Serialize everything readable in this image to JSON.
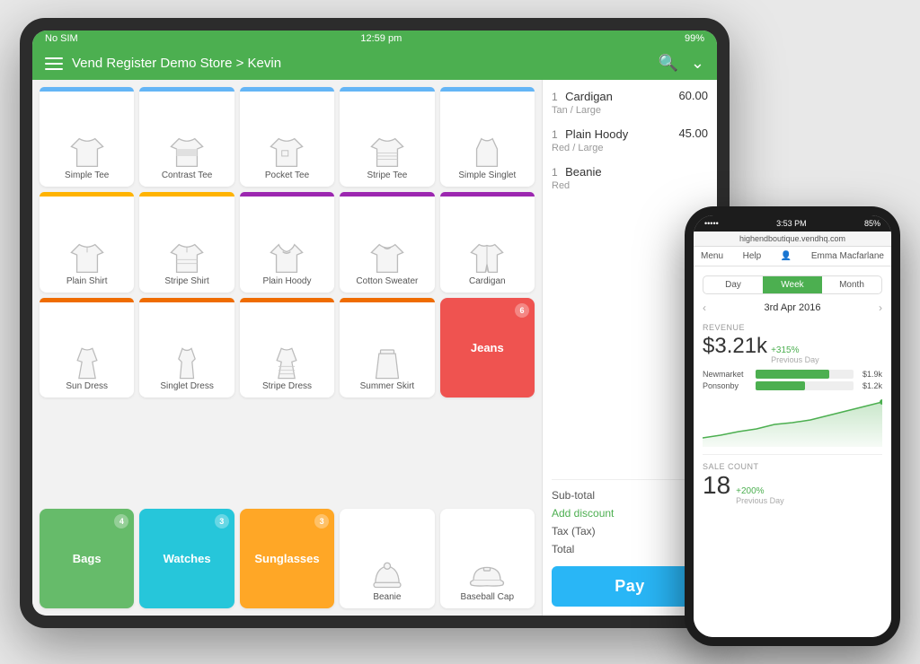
{
  "tablet": {
    "status_bar": {
      "carrier": "No SIM",
      "wifi": "wifi",
      "time": "12:59 pm",
      "battery": "99%"
    },
    "header": {
      "title": "Vend Register Demo Store > Kevin",
      "search_icon": "search",
      "chevron_icon": "chevron-down"
    },
    "products": [
      {
        "id": "simple-tee",
        "label": "Simple Tee",
        "bar_color": "bar-blue",
        "icon": "tee",
        "colored": false
      },
      {
        "id": "contrast-tee",
        "label": "Contrast Tee",
        "bar_color": "bar-blue",
        "icon": "contrast-tee",
        "colored": false
      },
      {
        "id": "pocket-tee",
        "label": "Pocket Tee",
        "bar_color": "bar-blue",
        "icon": "pocket-tee",
        "colored": false
      },
      {
        "id": "stripe-tee",
        "label": "Stripe Tee",
        "bar_color": "bar-blue",
        "icon": "stripe-tee",
        "colored": false
      },
      {
        "id": "simple-singlet",
        "label": "Simple Singlet",
        "bar_color": "bar-blue",
        "icon": "singlet",
        "colored": false
      },
      {
        "id": "plain-shirt",
        "label": "Plain Shirt",
        "bar_color": "bar-yellow",
        "icon": "shirt",
        "colored": false
      },
      {
        "id": "stripe-shirt",
        "label": "Stripe Shirt",
        "bar_color": "bar-yellow",
        "icon": "stripe-shirt",
        "colored": false
      },
      {
        "id": "plain-hoody",
        "label": "Plain Hoody",
        "bar_color": "bar-purple",
        "icon": "hoodie",
        "colored": false
      },
      {
        "id": "cotton-sweater",
        "label": "Cotton Sweater",
        "bar_color": "bar-purple",
        "icon": "sweater",
        "colored": false
      },
      {
        "id": "cardigan",
        "label": "Cardigan",
        "bar_color": "bar-purple",
        "icon": "cardigan",
        "colored": false
      },
      {
        "id": "sun-dress",
        "label": "Sun Dress",
        "bar_color": "bar-orange",
        "icon": "dress",
        "colored": false
      },
      {
        "id": "singlet-dress",
        "label": "Singlet Dress",
        "bar_color": "bar-orange",
        "icon": "singlet-dress",
        "colored": false
      },
      {
        "id": "stripe-dress",
        "label": "Stripe Dress",
        "bar_color": "bar-orange",
        "icon": "stripe-dress",
        "colored": false
      },
      {
        "id": "summer-skirt",
        "label": "Summer Skirt",
        "bar_color": "bar-orange",
        "icon": "skirt",
        "colored": false
      },
      {
        "id": "jeans",
        "label": "Jeans",
        "bar_color": "bar-red",
        "icon": "jeans",
        "colored": true,
        "color": "color-red",
        "badge": "6"
      },
      {
        "id": "empty1",
        "label": "",
        "empty": true
      },
      {
        "id": "empty2",
        "label": "",
        "empty": true
      },
      {
        "id": "empty3",
        "label": "",
        "empty": true
      },
      {
        "id": "empty4",
        "label": "",
        "empty": true
      },
      {
        "id": "empty5",
        "label": "",
        "empty": true
      },
      {
        "id": "bags",
        "label": "Bags",
        "colored": true,
        "color": "color-green",
        "badge": "4"
      },
      {
        "id": "watches",
        "label": "Watches",
        "colored": true,
        "color": "color-cyan",
        "badge": "3"
      },
      {
        "id": "sunglasses",
        "label": "Sunglasses",
        "colored": true,
        "color": "color-amber",
        "badge": "3"
      },
      {
        "id": "beanie",
        "label": "Beanie",
        "icon": "beanie",
        "colored": false
      },
      {
        "id": "baseball-cap",
        "label": "Baseball Cap",
        "icon": "cap",
        "colored": false
      }
    ],
    "cart": {
      "items": [
        {
          "qty": "1",
          "name": "Cardigan",
          "variant": "Tan / Large",
          "price": "60.00"
        },
        {
          "qty": "1",
          "name": "Plain Hoody",
          "variant": "Red / Large",
          "price": "45.00"
        },
        {
          "qty": "1",
          "name": "Beanie",
          "variant": "Red",
          "price": ""
        }
      ],
      "subtotal_label": "Sub-total",
      "add_discount_label": "Add discount",
      "tax_label": "Tax (Tax)",
      "total_label": "Total",
      "pay_label": "Pay"
    }
  },
  "phone": {
    "status_bar": {
      "carrier": "•••••",
      "time": "3:53 PM",
      "battery": "85%"
    },
    "url": "highendboutique.vendhq.com",
    "nav": {
      "menu": "Menu",
      "help": "Help",
      "user_icon": "user",
      "user_name": "Emma Macfarlane"
    },
    "tabs": [
      "Day",
      "Week",
      "Month"
    ],
    "active_tab": "Week",
    "date": "3rd Apr 2016",
    "revenue": {
      "label": "REVENUE",
      "value": "$3.21k",
      "change": "+315%",
      "change_label": "Previous Day",
      "locations": [
        {
          "name": "Newmarket",
          "value": "$1.9k",
          "pct": 75
        },
        {
          "name": "Ponsonby",
          "value": "$1.2k",
          "pct": 50
        }
      ]
    },
    "sale_count": {
      "label": "SALE COUNT",
      "value": "18",
      "change": "+200%",
      "change_label": "Previous Day"
    }
  }
}
